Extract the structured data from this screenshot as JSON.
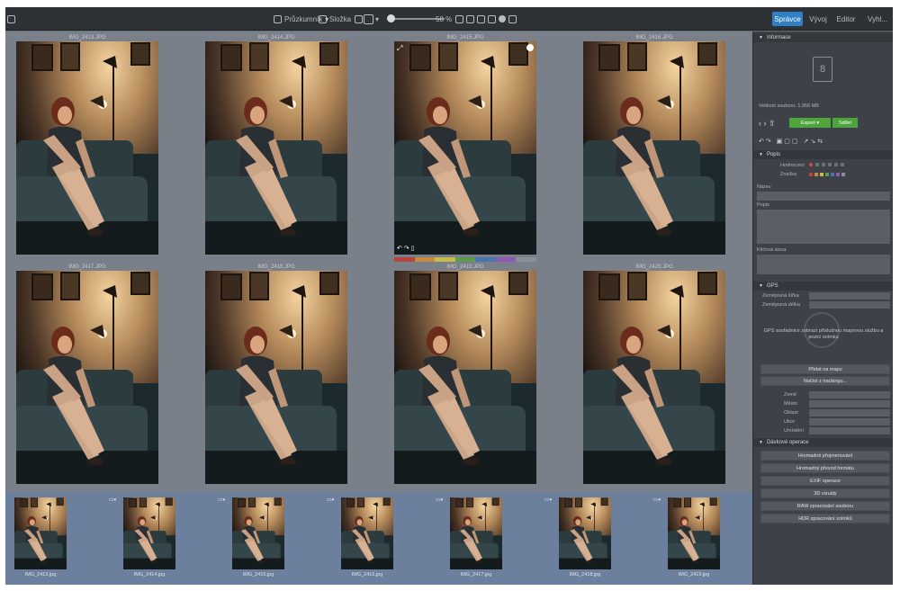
{
  "toolbar": {
    "left_icon": "camera-icon",
    "filter_label": "Průzkumník",
    "sort_label": "Složka",
    "zoom_value": "58 %",
    "accent": "#2f7fc4"
  },
  "modes": [
    {
      "label": "Správce",
      "active": true
    },
    {
      "label": "Vývoj",
      "active": false
    },
    {
      "label": "Editor",
      "active": false
    },
    {
      "label": "Vyhl...",
      "active": false
    }
  ],
  "grid": {
    "rows": [
      [
        {
          "caption": "IMG_2413.JPG",
          "selected": false
        },
        {
          "caption": "IMG_2414.JPG",
          "selected": false
        },
        {
          "caption": "IMG_2415.JPG",
          "selected": true
        },
        {
          "caption": "IMG_2416.JPG",
          "selected": false
        }
      ],
      [
        {
          "caption": "IMG_2417.JPG",
          "selected": false
        },
        {
          "caption": "IMG_2418.JPG",
          "selected": false
        },
        {
          "caption": "IMG_2419.JPG",
          "selected": false
        },
        {
          "caption": "IMG_2420.JPG",
          "selected": false
        }
      ]
    ],
    "label_colors": [
      "#b7443e",
      "#c58a3f",
      "#c9b94a",
      "#5c9a4c",
      "#4a76b0",
      "#8a5bb0",
      "#8b9096"
    ]
  },
  "filmstrip": [
    {
      "name": "IMG_2413.jpg"
    },
    {
      "name": "IMG_2414.jpg"
    },
    {
      "name": "IMG_2415.jpg"
    },
    {
      "name": "IMG_2416.jpg"
    },
    {
      "name": "IMG_2417.jpg"
    },
    {
      "name": "IMG_2418.jpg"
    },
    {
      "name": "IMG_2419.jpg"
    }
  ],
  "panel": {
    "info_title": "Informace",
    "file_size": "Velikost souboru: 1,956 MB",
    "export_label": "Export",
    "share_label": "Sdílet",
    "props_title": "Popis",
    "rating_label": "Hodnocení",
    "color_label": "Značka",
    "title_label": "Název",
    "desc_label": "Popis",
    "keywords_label": "Klíčová slova",
    "gps_title": "GPS",
    "gps_lat": "Zeměpisná šířka",
    "gps_lon": "Zeměpisná délka",
    "gps_note": "GPS souřadnice zobrazí příslušnou mapovou službu a pozici snímku",
    "gps_btn1": "Přidat na mapu",
    "gps_btn2": "Načíst z trackingu...",
    "addr_labels": [
      "Země",
      "Město",
      "Oblast",
      "Ulice",
      "Umístění"
    ],
    "actions_title": "Dávkové operace",
    "actions": [
      "Hromadné přejmenování",
      "Hromadný převod formátu",
      "EXIF operace",
      "3D vizuály",
      "RAW zpracování souboru",
      "HDR zpracování snímků"
    ]
  }
}
